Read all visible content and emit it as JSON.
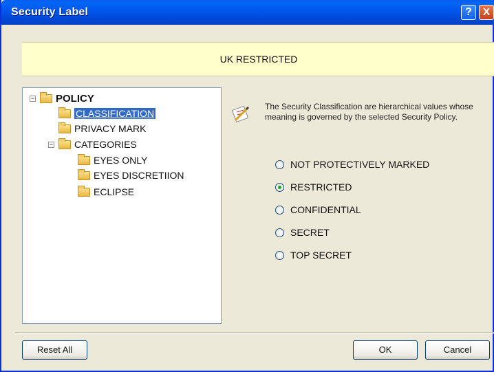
{
  "window": {
    "title": "Security Label",
    "help_label": "?",
    "close_label": "X"
  },
  "banner": {
    "text": "UK RESTRICTED"
  },
  "tree": {
    "root": {
      "label": "POLICY",
      "expander": "−"
    },
    "items": [
      {
        "label": "CLASSIFICATION",
        "selected": true
      },
      {
        "label": "PRIVACY MARK"
      },
      {
        "label": "CATEGORIES",
        "expander": "−"
      },
      {
        "label": "EYES ONLY"
      },
      {
        "label": "EYES DISCRETIION"
      },
      {
        "label": "ECLIPSE"
      }
    ]
  },
  "description": {
    "icon": "pen-and-paper-icon",
    "text": "The Security Classification are hierarchical values whose meaning is governed by the selected Security Policy."
  },
  "classification_options": [
    {
      "label": "NOT PROTECTIVELY MARKED",
      "checked": false
    },
    {
      "label": "RESTRICTED",
      "checked": true
    },
    {
      "label": "CONFIDENTIAL",
      "checked": false
    },
    {
      "label": "SECRET",
      "checked": false
    },
    {
      "label": "TOP SECRET",
      "checked": false
    }
  ],
  "buttons": {
    "reset_all": "Reset All",
    "ok": "OK",
    "cancel": "Cancel"
  }
}
